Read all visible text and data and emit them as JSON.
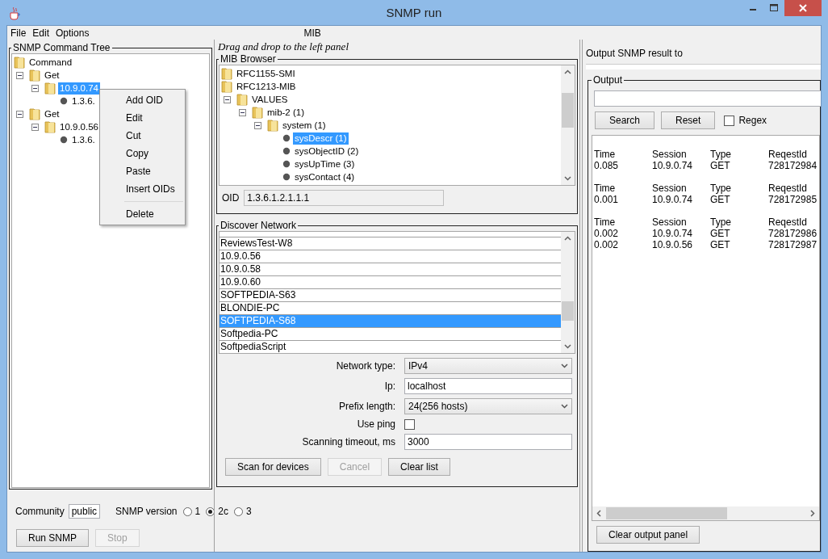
{
  "window": {
    "title": "SNMP run"
  },
  "menu": [
    "File",
    "Edit",
    "Options"
  ],
  "mib_header": "MIB",
  "command_tree": {
    "title": "SNMP Command Tree",
    "nodes": [
      {
        "label": "Command",
        "kind": "folder",
        "selected": false,
        "children": [
          {
            "label": "Get",
            "kind": "folder",
            "expanded": true,
            "selected": false,
            "children": [
              {
                "label": "10.9.0.74",
                "kind": "folder",
                "expanded": true,
                "selected": true,
                "children": [
                  {
                    "label": "1.3.6.",
                    "kind": "leaf",
                    "selected": false
                  }
                ]
              }
            ]
          },
          {
            "label": "Get",
            "kind": "folder",
            "expanded": true,
            "selected": false,
            "children": [
              {
                "label": "10.9.0.56",
                "kind": "folder",
                "expanded": true,
                "selected": false,
                "children": [
                  {
                    "label": "1.3.6.",
                    "kind": "leaf",
                    "selected": false
                  }
                ]
              }
            ]
          }
        ]
      }
    ]
  },
  "context_menu": [
    {
      "kind": "item",
      "label": "Add OID"
    },
    {
      "kind": "item",
      "label": "Edit"
    },
    {
      "kind": "item",
      "label": "Cut"
    },
    {
      "kind": "item",
      "label": "Copy"
    },
    {
      "kind": "item",
      "label": "Paste"
    },
    {
      "kind": "item",
      "label": "Insert OIDs"
    },
    {
      "kind": "separator"
    },
    {
      "kind": "item",
      "label": "Delete"
    }
  ],
  "community": {
    "label": "Community",
    "value": "public"
  },
  "snmp_version": {
    "label": "SNMP version",
    "options": [
      {
        "label": "1",
        "selected": false
      },
      {
        "label": "2c",
        "selected": true
      },
      {
        "label": "3",
        "selected": false
      }
    ]
  },
  "command_buttons": [
    {
      "label": "Run SNMP",
      "disabled": false
    },
    {
      "label": "Stop",
      "disabled": true
    }
  ],
  "hint": "Drag and drop to the left panel",
  "mib_browser": {
    "title": "MIB Browser",
    "nodes": [
      {
        "label": "RFC1155-SMI",
        "kind": "folder",
        "selected": false
      },
      {
        "label": "RFC1213-MIB",
        "kind": "folder",
        "selected": false,
        "children": [
          {
            "label": "VALUES",
            "kind": "folder",
            "expanded": true,
            "selected": false,
            "children": [
              {
                "label": "mib-2 (1)",
                "kind": "folder",
                "expanded": true,
                "selected": false,
                "children": [
                  {
                    "label": "system (1)",
                    "kind": "folder",
                    "expanded": true,
                    "selected": false,
                    "children": [
                      {
                        "label": "sysDescr (1)",
                        "kind": "leaf",
                        "selected": true
                      },
                      {
                        "label": "sysObjectID (2)",
                        "kind": "leaf",
                        "selected": false
                      },
                      {
                        "label": "sysUpTime (3)",
                        "kind": "leaf",
                        "selected": false
                      },
                      {
                        "label": "sysContact (4)",
                        "kind": "leaf",
                        "selected": false
                      }
                    ]
                  }
                ]
              }
            ]
          }
        ]
      }
    ],
    "oid": {
      "label": "OID",
      "value": "1.3.6.1.2.1.1.1"
    }
  },
  "discover": {
    "title": "Discover Network",
    "hosts": [
      {
        "name": "ReviewsTest-W8",
        "selected": false
      },
      {
        "name": "10.9.0.56",
        "selected": false
      },
      {
        "name": "10.9.0.58",
        "selected": false
      },
      {
        "name": "10.9.0.60",
        "selected": false
      },
      {
        "name": "SOFTPEDIA-S63",
        "selected": false
      },
      {
        "name": "BLONDIE-PC",
        "selected": false
      },
      {
        "name": "SOFTPEDIA-S68",
        "selected": true
      },
      {
        "name": "Softpedia-PC",
        "selected": false
      },
      {
        "name": "SoftpediaScript",
        "selected": false
      }
    ],
    "form": [
      {
        "kind": "select",
        "label": "Network type:",
        "value": "IPv4"
      },
      {
        "kind": "text",
        "label": "Ip:",
        "value": "localhost"
      },
      {
        "kind": "select",
        "label": "Prefix length:",
        "value": "24(256 hosts)"
      },
      {
        "kind": "checkbox",
        "label": "Use ping",
        "checked": false
      },
      {
        "kind": "text",
        "label": "Scanning timeout, ms",
        "value": "3000"
      }
    ],
    "buttons": [
      {
        "label": "Scan for devices",
        "disabled": false
      },
      {
        "label": "Cancel",
        "disabled": true
      },
      {
        "label": "Clear list",
        "disabled": false
      }
    ]
  },
  "output": {
    "heading": "Output SNMP result to",
    "title": "Output",
    "buttons": [
      "Search",
      "Reset"
    ],
    "regex": {
      "label": "Regex",
      "checked": false
    },
    "groups": [
      {
        "columns": [
          "Time",
          "Session",
          "Type",
          "ReqestId"
        ],
        "rows": [
          [
            "0.085",
            "10.9.0.74",
            "GET",
            "728172984"
          ]
        ]
      },
      {
        "columns": [
          "Time",
          "Session",
          "Type",
          "ReqestId"
        ],
        "rows": [
          [
            "0.001",
            "10.9.0.74",
            "GET",
            "728172985"
          ]
        ]
      },
      {
        "columns": [
          "Time",
          "Session",
          "Type",
          "ReqestId"
        ],
        "rows": [
          [
            "0.002",
            "10.9.0.74",
            "GET",
            "728172986"
          ],
          [
            "0.002",
            "10.9.0.56",
            "GET",
            "728172987"
          ]
        ]
      }
    ],
    "clear_button": "Clear output panel"
  }
}
